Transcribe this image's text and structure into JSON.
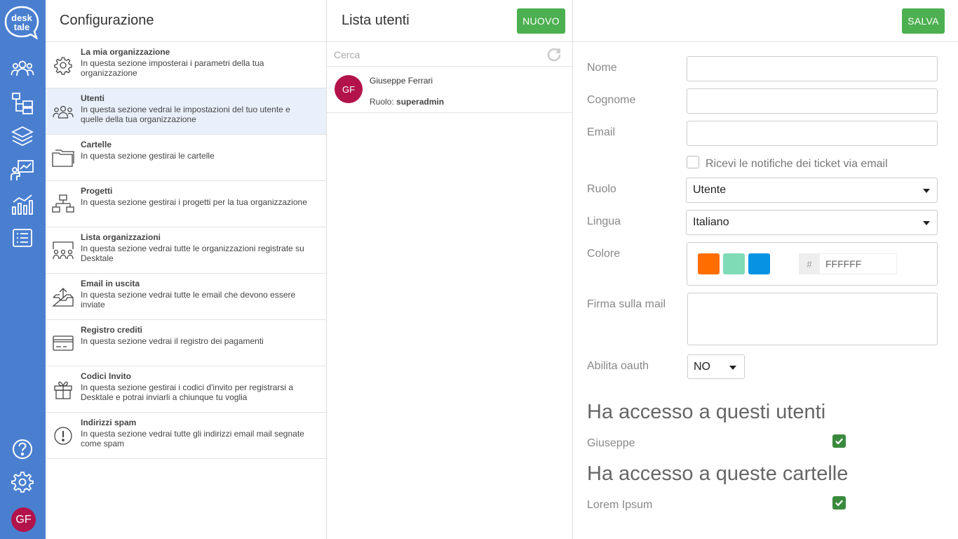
{
  "brand": {
    "logo_line1": "desk",
    "logo_line2": "tale"
  },
  "rail": {
    "items": [
      {
        "icon": "users-icon"
      },
      {
        "icon": "folder-tree-icon"
      },
      {
        "icon": "layers-icon"
      },
      {
        "icon": "presentation-chart-icon"
      },
      {
        "icon": "bar-chart-icon"
      },
      {
        "icon": "list-icon"
      }
    ],
    "bottom": [
      {
        "icon": "help-icon"
      },
      {
        "icon": "settings-icon"
      }
    ],
    "avatar_initials": "GF"
  },
  "config": {
    "title": "Configurazione",
    "items": [
      {
        "title": "La mia organizzazione",
        "desc": "In questa sezione imposterai i parametri della tua organizzazione",
        "icon": "gear-icon",
        "active": false
      },
      {
        "title": "Utenti",
        "desc": "In questa sezione vedrai le impostazioni del tuo utente e quelle della tua organizzazione",
        "icon": "users-icon",
        "active": true
      },
      {
        "title": "Cartelle",
        "desc": "In questa sezione gestirai le cartelle",
        "icon": "folder-icon",
        "active": false
      },
      {
        "title": "Progetti",
        "desc": "In questa sezione gestirai i progetti per la tua organizzazione",
        "icon": "sitemap-icon",
        "active": false
      },
      {
        "title": "Lista organizzazioni",
        "desc": "In questa sezione vedrai tutte le organizzazioni registrate su Desktale",
        "icon": "organizations-icon",
        "active": false
      },
      {
        "title": "Email in uscita",
        "desc": "In questa sezione vedrai tutte le email che devono essere inviate",
        "icon": "outbox-icon",
        "active": false
      },
      {
        "title": "Registro crediti",
        "desc": "In questa sezione vedrai il registro dei pagamenti",
        "icon": "credit-card-icon",
        "active": false
      },
      {
        "title": "Codici Invito",
        "desc": "In questa sezione gestirai i codici d'invito per registrarsi a Desktale e potrai inviarli a chiunque tu voglia",
        "icon": "gift-icon",
        "active": false
      },
      {
        "title": "Indirizzi spam",
        "desc": "In questa sezione vedrai tutte gli indirizzi email mail segnate come spam",
        "icon": "alert-circle-icon",
        "active": false
      }
    ]
  },
  "users": {
    "title": "Lista utenti",
    "new_label": "NUOVO",
    "search_placeholder": "Cerca",
    "list": [
      {
        "initials": "GF",
        "name": "Giuseppe Ferrari",
        "role_label": "Ruolo:",
        "role": "superadmin"
      }
    ]
  },
  "detail": {
    "save_label": "SALVA",
    "labels": {
      "nome": "Nome",
      "cognome": "Cognome",
      "email": "Email",
      "notify": "Ricevi le notifiche dei ticket via email",
      "ruolo": "Ruolo",
      "lingua": "Lingua",
      "colore": "Colore",
      "firma": "Firma sulla mail",
      "oauth": "Abilita oauth"
    },
    "values": {
      "nome": "",
      "cognome": "",
      "email": "",
      "notify_checked": false,
      "ruolo": "Utente",
      "lingua": "Italiano",
      "hex_prefix": "#",
      "color_hex": "FFFFFF",
      "firma": "",
      "oauth": "NO"
    },
    "swatches": [
      "#ff6d00",
      "#7fdbb6",
      "#0693e3"
    ],
    "users_access": {
      "heading": "Ha accesso a questi utenti",
      "items": [
        {
          "label": "Giuseppe",
          "checked": true
        }
      ]
    },
    "folders_access": {
      "heading": "Ha accesso a queste cartelle",
      "items": [
        {
          "label": "Lorem Ipsum",
          "checked": true
        }
      ]
    }
  },
  "colors": {
    "rail": "#4a7fd0",
    "accent_green": "#4caf50",
    "check_green": "#3a8a3e",
    "avatar": "#b3134b",
    "active_row": "#eaf0fb"
  }
}
